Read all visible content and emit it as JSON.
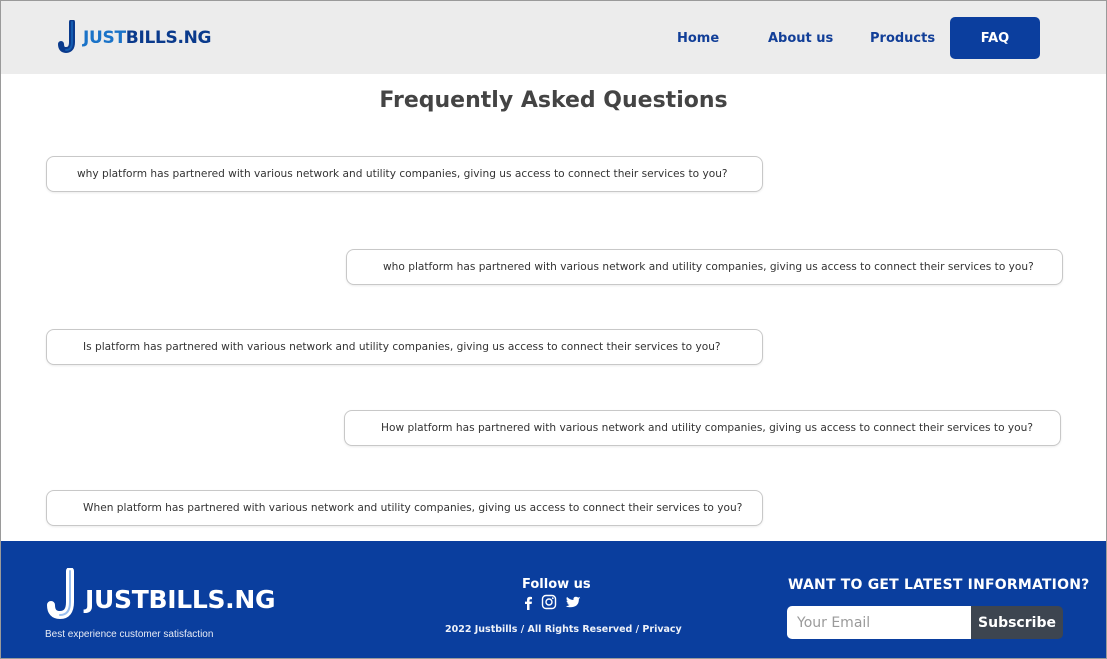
{
  "header": {
    "logo": {
      "part1": "JUST",
      "part2": "BILLS.NG"
    },
    "nav": {
      "home": "Home",
      "about": "About us",
      "products": "Products",
      "faq": "FAQ"
    }
  },
  "main": {
    "title": "Frequently Asked Questions",
    "questions": [
      "why platform has partnered with various network and  utility companies, giving us access to connect their services to you?",
      "who platform has partnered with various network and  utility companies, giving us access to connect their services to you?",
      "Is platform has partnered with various network and  utility companies, giving us access to connect their services to you?",
      "How platform has partnered with various network and  utility companies, giving us access to connect their services to you?",
      "When  platform has partnered with various network and  utility companies, giving us access to connect their services to you?"
    ]
  },
  "footer": {
    "logo_text": "JUSTBILLS.NG",
    "tagline": "Best experience customer  satisfaction",
    "follow_title": "Follow us",
    "social_icons": [
      "facebook-icon",
      "instagram-icon",
      "twitter-icon"
    ],
    "copyright": "2022 Justbills / All Rights Reserved / Privacy",
    "newsletter_title": "WANT TO GET LATEST INFORMATION?",
    "email_placeholder": "Your Email",
    "subscribe_label": "Subscribe"
  },
  "colors": {
    "header_bg": "#ececec",
    "brand_light_blue": "#1a73c8",
    "brand_dark_blue": "#0a3a8c",
    "nav_active_bg": "#0b3e9e",
    "footer_bg": "#0a3e9e",
    "subscribe_bg": "#3d4550"
  }
}
